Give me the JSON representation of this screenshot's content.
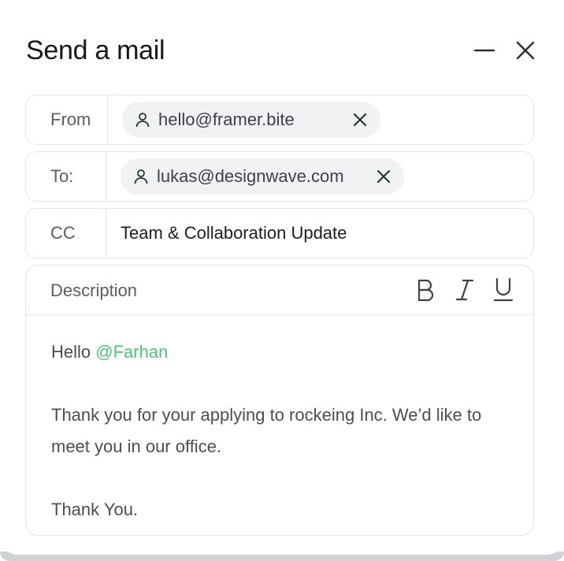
{
  "window": {
    "title": "Send a mail",
    "minimize_icon": "minus-icon",
    "close_icon": "close-icon"
  },
  "from": {
    "label": "From",
    "chip": {
      "email": "hello@framer.bite",
      "icon": "person-icon",
      "remove_icon": "close-icon"
    }
  },
  "to": {
    "label": "To:",
    "chip": {
      "email": "lukas@designwave.com",
      "icon": "person-icon",
      "remove_icon": "close-icon"
    }
  },
  "cc": {
    "label": "CC",
    "value": "Team & Collaboration Update"
  },
  "description": {
    "label": "Description",
    "toolbar": [
      "bold-icon",
      "italic-icon",
      "underline-icon"
    ],
    "greeting": "Hello",
    "mention": "@Farhan",
    "body": "Thank you for your  applying to rockeing Inc. We’d like to meet you in our office.",
    "signoff": "Thank You."
  },
  "colors": {
    "mention": "#4cc77a",
    "border": "#e3e5e7",
    "chip_bg": "#f1f2f3",
    "chip_icon": "#1f3a2e"
  }
}
